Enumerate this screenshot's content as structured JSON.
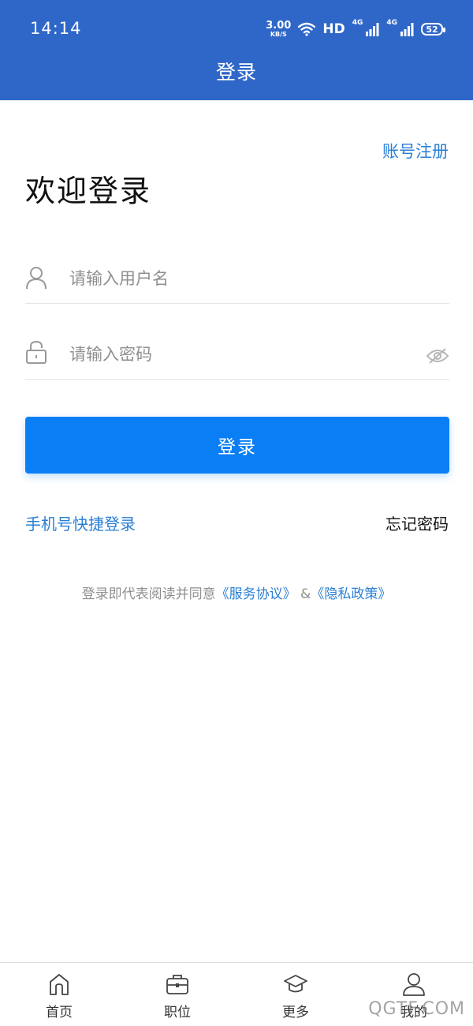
{
  "status_bar": {
    "time": "14:14",
    "net_speed_value": "3.00",
    "net_speed_unit": "KB/S",
    "hd_label": "HD",
    "sim1_label": "4G",
    "sim2_label": "4G",
    "battery": "52"
  },
  "header": {
    "title": "登录"
  },
  "register_link": "账号注册",
  "welcome": "欢迎登录",
  "username": {
    "placeholder": "请输入用户名",
    "value": ""
  },
  "password": {
    "placeholder": "请输入密码",
    "value": ""
  },
  "login_button": "登录",
  "quick_login": "手机号快捷登录",
  "forgot_password": "忘记密码",
  "agreement": {
    "prefix": "登录即代表阅读并同意",
    "service": "《服务协议》",
    "amp": " &",
    "privacy": "《隐私政策》"
  },
  "bottom_nav": [
    {
      "label": "首页",
      "icon": "home-icon"
    },
    {
      "label": "职位",
      "icon": "briefcase-icon"
    },
    {
      "label": "更多",
      "icon": "graduation-cap-icon"
    },
    {
      "label": "我的",
      "icon": "user-icon"
    }
  ],
  "watermark": "QGTF.COM",
  "colors": {
    "primary": "#2f67c9",
    "button": "#0a7ff5",
    "link": "#2a7fd4"
  }
}
